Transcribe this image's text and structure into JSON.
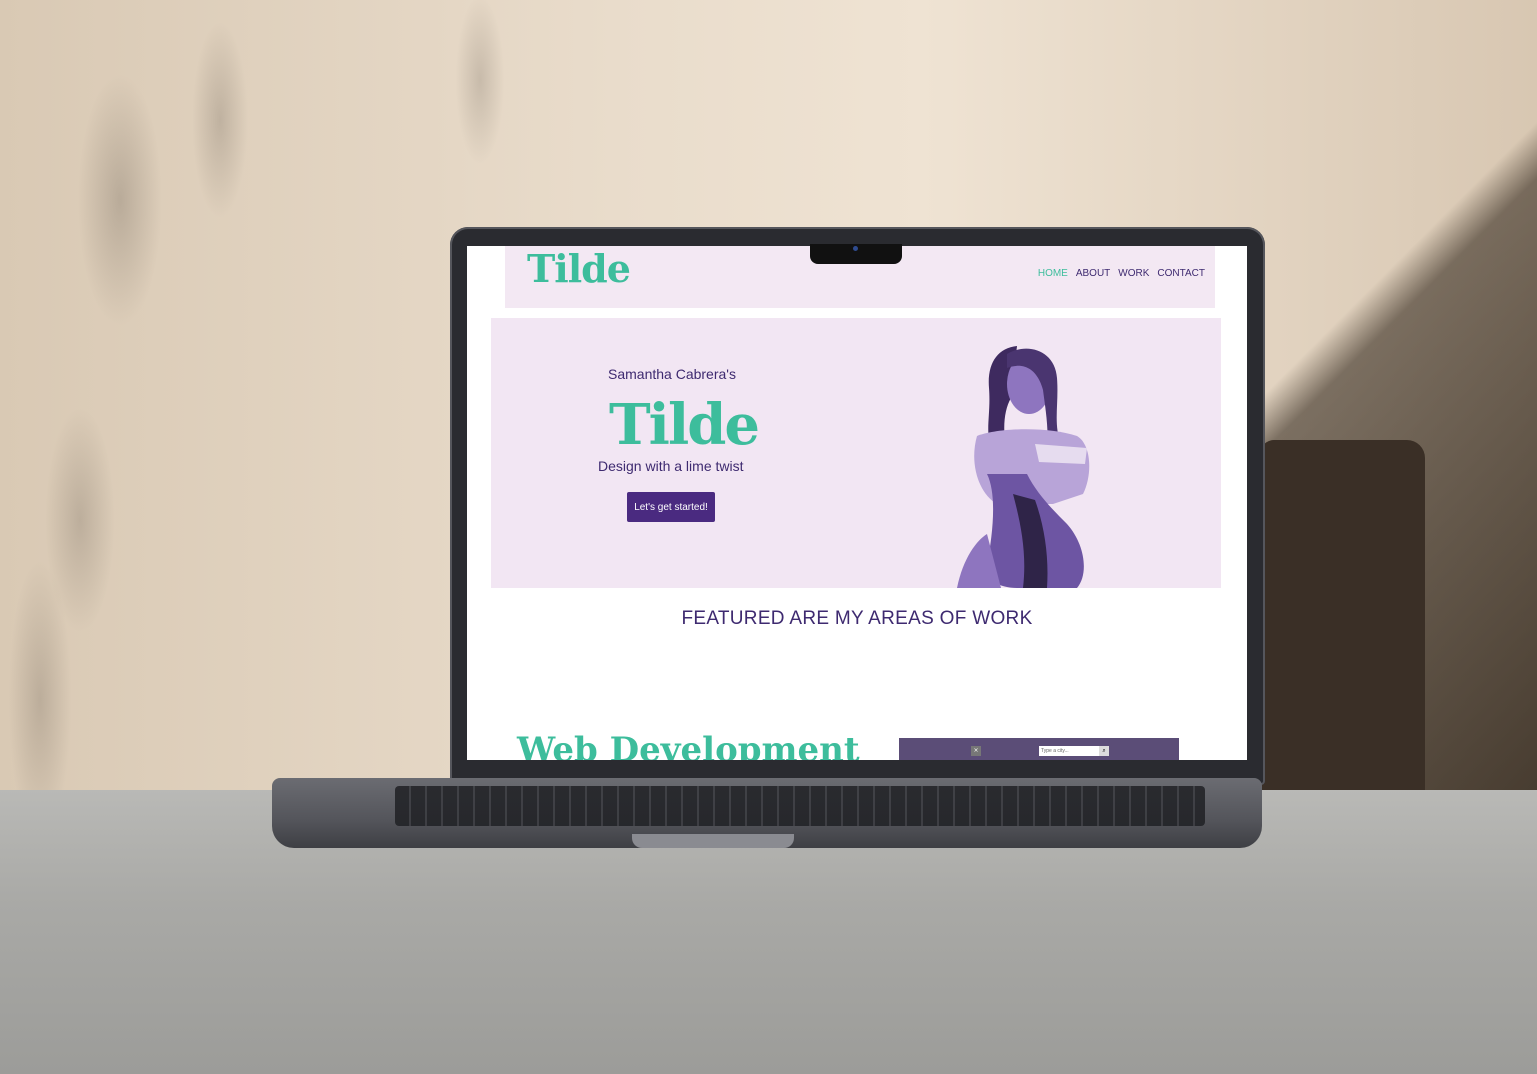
{
  "site": {
    "logo": "Tilde",
    "nav": [
      {
        "label": "HOME",
        "active": true
      },
      {
        "label": "ABOUT",
        "active": false
      },
      {
        "label": "WORK",
        "active": false
      },
      {
        "label": "CONTACT",
        "active": false
      }
    ]
  },
  "hero": {
    "subtitle": "Samantha Cabrera's",
    "title": "Tilde",
    "tagline": "Design with a lime twist",
    "cta_label": "Let's get started!"
  },
  "featured_heading": "FEATURED ARE MY AREAS OF WORK",
  "next_section_title": "Web Development",
  "preview": {
    "search_placeholder": "Type a city...",
    "close_icon": "×",
    "search_button_icon": "search-icon"
  },
  "colors": {
    "accent": "#3dbd9c",
    "primary": "#3e2a70",
    "button": "#4a2a80",
    "panel": "#f2e6f3"
  }
}
